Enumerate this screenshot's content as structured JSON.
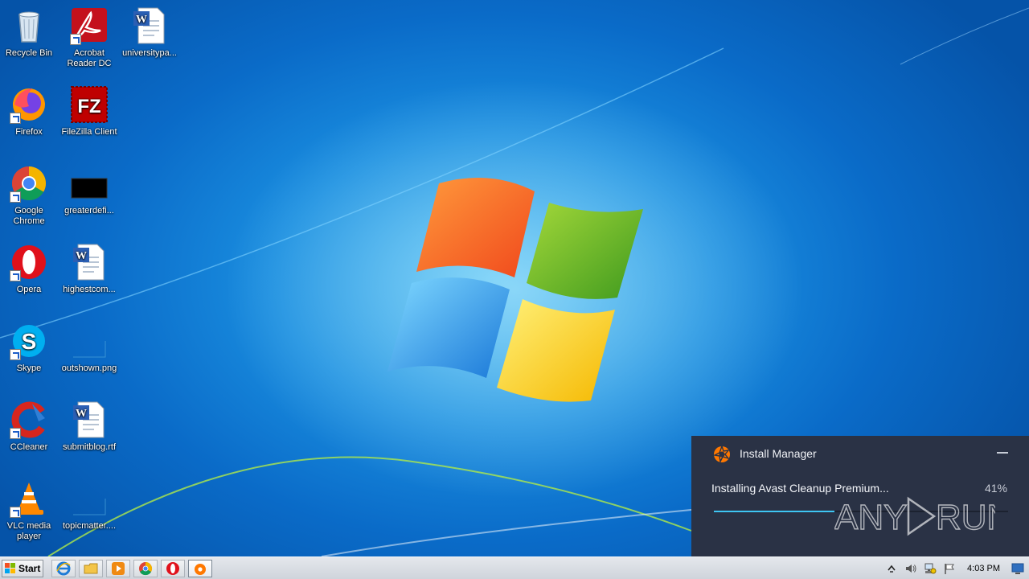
{
  "desktop": {
    "icons": [
      {
        "label": "Recycle Bin",
        "icon": "recycle-bin-icon"
      },
      {
        "label": "Acrobat Reader DC",
        "icon": "acrobat-icon"
      },
      {
        "label": "universitypa...",
        "icon": "word-document-icon"
      },
      {
        "label": "Firefox",
        "icon": "firefox-icon"
      },
      {
        "label": "FileZilla Client",
        "icon": "filezilla-icon"
      },
      {
        "label": "Google Chrome",
        "icon": "chrome-icon"
      },
      {
        "label": "greaterdefi...",
        "icon": "black-image-icon"
      },
      {
        "label": "Opera",
        "icon": "opera-icon"
      },
      {
        "label": "highestcom...",
        "icon": "word-document-icon"
      },
      {
        "label": "Skype",
        "icon": "skype-icon"
      },
      {
        "label": "outshown.png",
        "icon": "png-file-icon"
      },
      {
        "label": "CCleaner",
        "icon": "ccleaner-icon"
      },
      {
        "label": "submitblog.rtf",
        "icon": "word-document-icon"
      },
      {
        "label": "VLC media player",
        "icon": "vlc-icon"
      },
      {
        "label": "topicmatter....",
        "icon": "png-file-icon"
      }
    ]
  },
  "installer": {
    "title": "Install Manager",
    "status": "Installing Avast Cleanup Premium...",
    "percent_label": "41%",
    "progress": 0.41,
    "accent": "#3ec6f3",
    "background": "#2a3245",
    "logo_color": "#ff7800"
  },
  "watermark": {
    "text": "ANY RUN"
  },
  "taskbar": {
    "start_label": "Start",
    "pinned": [
      {
        "name": "internet-explorer-icon"
      },
      {
        "name": "file-explorer-icon"
      },
      {
        "name": "media-player-icon"
      },
      {
        "name": "chrome-icon"
      },
      {
        "name": "opera-icon"
      },
      {
        "name": "avast-installer-icon",
        "active": true
      }
    ],
    "tray": {
      "clock": "4:03 PM",
      "icons": [
        "show-hidden-icons-arrow",
        "volume-icon",
        "network-icon",
        "action-center-flag-icon"
      ]
    }
  }
}
